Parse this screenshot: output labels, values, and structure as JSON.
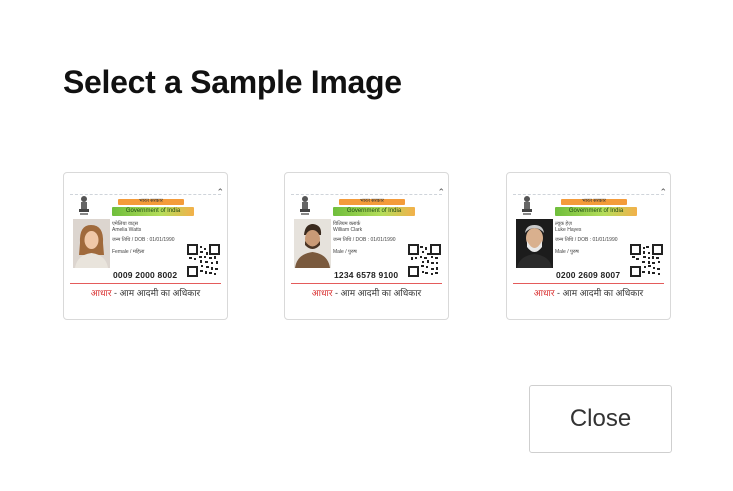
{
  "dialog": {
    "title": "Select a Sample Image"
  },
  "samples": [
    {
      "govt_hindi": "भारत सरकार",
      "govt_english": "Government of India",
      "name_hindi": "एमेलिया वाट्स",
      "name_english": "Amelia Watts",
      "dob": "जन्म तिथि / DOB : 01/01/1990",
      "gender": "Female / महिला",
      "uid": "0009 2000 8002",
      "tagline_red": "आधार",
      "tagline_rest": " - आम आदमी का अधिकार"
    },
    {
      "govt_hindi": "भारत सरकार",
      "govt_english": "Government of India",
      "name_hindi": "विलियम क्लार्क",
      "name_english": "William Clark",
      "dob": "जन्म तिथि / DOB : 01/01/1990",
      "gender": "Male / पुरुष",
      "uid": "1234 6578 9100",
      "tagline_red": "आधार",
      "tagline_rest": " - आम आदमी का अधिकार"
    },
    {
      "govt_hindi": "भारत सरकार",
      "govt_english": "Government of India",
      "name_hindi": "ल्यूक हेज़",
      "name_english": "Luke Hayes",
      "dob": "जन्म तिथि / DOB : 01/01/1990",
      "gender": "Male / पुरुष",
      "uid": "0200 2609 8007",
      "tagline_red": "आधार",
      "tagline_rest": " - आम आदमी का अधिकार"
    }
  ],
  "footer": {
    "close_label": "Close"
  },
  "colors": {
    "saffron": "#f49b3a",
    "green": "#6fbe3c",
    "red_line": "#e45b5b",
    "tagline_red": "#d93030"
  }
}
